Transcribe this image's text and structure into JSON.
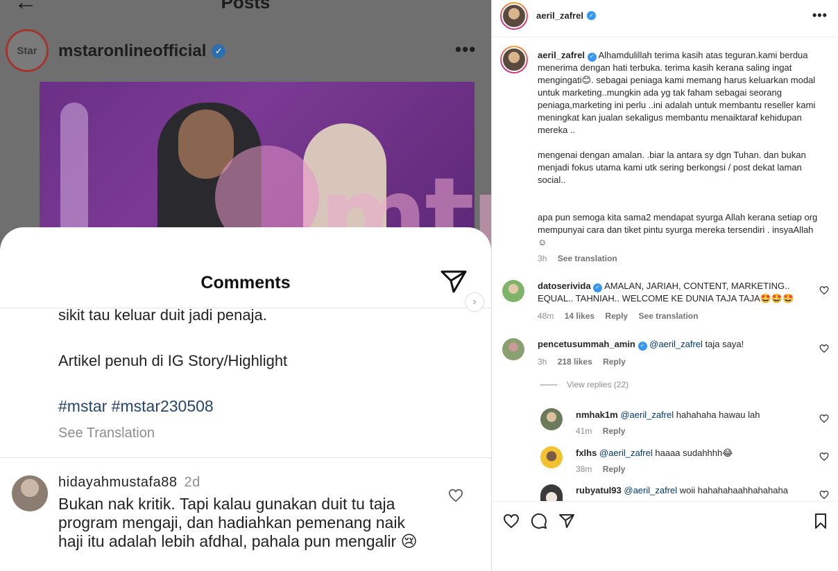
{
  "left_post": {
    "header_title": "Posts",
    "account_name": "mstaronlineofficial",
    "avatar_text": "Star",
    "watermark_text": "mtural",
    "comments_title": "Comments",
    "caption_lines": [
      "sikit tau keluar duit jadi penaja.",
      "Artikel penuh di IG Story/Highlight"
    ],
    "hashtags": "#mstar #mstar230508",
    "see_translation": "See Translation",
    "comment": {
      "username": "hidayahmustafa88",
      "time": "2d",
      "text": "Bukan nak kritik. Tapi kalau gunakan duit tu taja program mengaji,  dan hadiahkan pemenang naik haji itu adalah lebih afdhal,  pahala pun mengalir 😢"
    }
  },
  "right_post": {
    "username": "aeril_zafrel",
    "caption": {
      "username": "aeril_zafrel",
      "paragraph1": "Alhamdulillah terima kasih atas teguran.kami berdua menerima dengan hati terbuka. terima kasih kerana saling ingat mengingati😊. sebagai peniaga kami memang harus keluarkan modal untuk marketing..mungkin ada yg tak faham sebagai seorang peniaga,marketing ini perlu ..ini adalah untuk membantu reseller kami meningkat kan jualan sekaligus membantu menaiktaraf kehidupan mereka ..",
      "paragraph2": "mengenai dengan amalan. .biar la antara sy dgn Tuhan. dan bukan menjadi fokus utama kami utk sering berkongsi / post dekat laman social..",
      "paragraph3": "apa pun semoga kita sama2 mendapat syurga Allah kerana setiap org mempunyai cara dan tiket pintu syurga mereka tersendiri . insyaAllah ☺",
      "time": "3h",
      "see_translation": "See translation"
    },
    "comments": [
      {
        "username": "datoserivida",
        "text": "AMALAN, JARIAH, CONTENT, MARKETING.. EQUAL.. TAHNIAH.. WELCOME KE DUNIA TAJA TAJA🤩🤩🤩",
        "time": "48m",
        "likes": "14 likes",
        "reply": "Reply",
        "see_translation": "See translation"
      },
      {
        "username": "pencetusummah_amin",
        "mention": "@aeril_zafrel",
        "text": "taja saya!",
        "time": "3h",
        "likes": "218 likes",
        "reply": "Reply"
      }
    ],
    "view_replies": "View replies (22)",
    "replies": [
      {
        "username": "nmhak1m",
        "mention": "@aeril_zafrel",
        "text": "hahahaha hawau lah",
        "time": "41m",
        "reply": "Reply"
      },
      {
        "username": "fxlhs",
        "mention": "@aeril_zafrel",
        "text": "haaaa sudahhhh😂",
        "time": "38m",
        "reply": "Reply"
      },
      {
        "username": "rubyatul93",
        "mention": "@aeril_zafrel",
        "text": "woii hahahahaahhahahaha"
      }
    ]
  }
}
